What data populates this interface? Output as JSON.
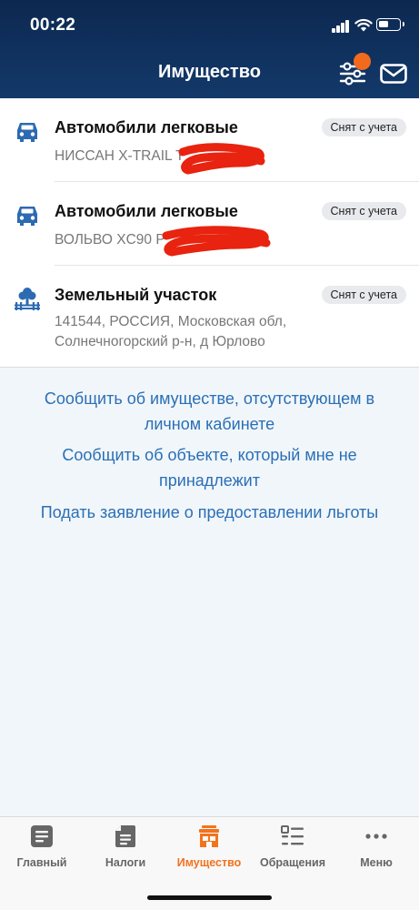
{
  "status_bar": {
    "time": "00:22"
  },
  "header": {
    "title": "Имущество"
  },
  "items": [
    {
      "title": "Автомобили легковые",
      "subtitle": "НИССАН X-TRAIL T",
      "badge": "Снят с учета",
      "icon": "car-icon"
    },
    {
      "title": "Автомобили легковые",
      "subtitle": "ВОЛЬВО XC90 P",
      "badge": "Снят с учета",
      "icon": "car-icon"
    },
    {
      "title": "Земельный участок",
      "subtitle_line1": "141544, РОССИЯ, Московская обл,",
      "subtitle_line2": "Солнечногорский р-н, д Юрлово",
      "badge": "Снят с учета",
      "icon": "land-plot-icon"
    }
  ],
  "links": {
    "report_missing_line1": "Сообщить об имуществе, отсутствующем в",
    "report_missing_line2": "личном кабинете",
    "report_not_mine_line1": "Сообщить об объекте, который мне не",
    "report_not_mine_line2": "принадлежит",
    "apply_benefit": "Подать заявление о предоставлении льготы"
  },
  "tabs": [
    {
      "label": "Главный",
      "icon": "document-icon"
    },
    {
      "label": "Налоги",
      "icon": "tax-file-icon"
    },
    {
      "label": "Имущество",
      "icon": "property-icon",
      "active": true
    },
    {
      "label": "Обращения",
      "icon": "requests-list-icon"
    },
    {
      "label": "Меню",
      "icon": "more-dots-icon"
    }
  ],
  "colors": {
    "header": "#13396a",
    "accent": "#f2731e",
    "link": "#2a6fb6",
    "icon_blue": "#2c6ab1",
    "redaction": "#e8230f"
  }
}
